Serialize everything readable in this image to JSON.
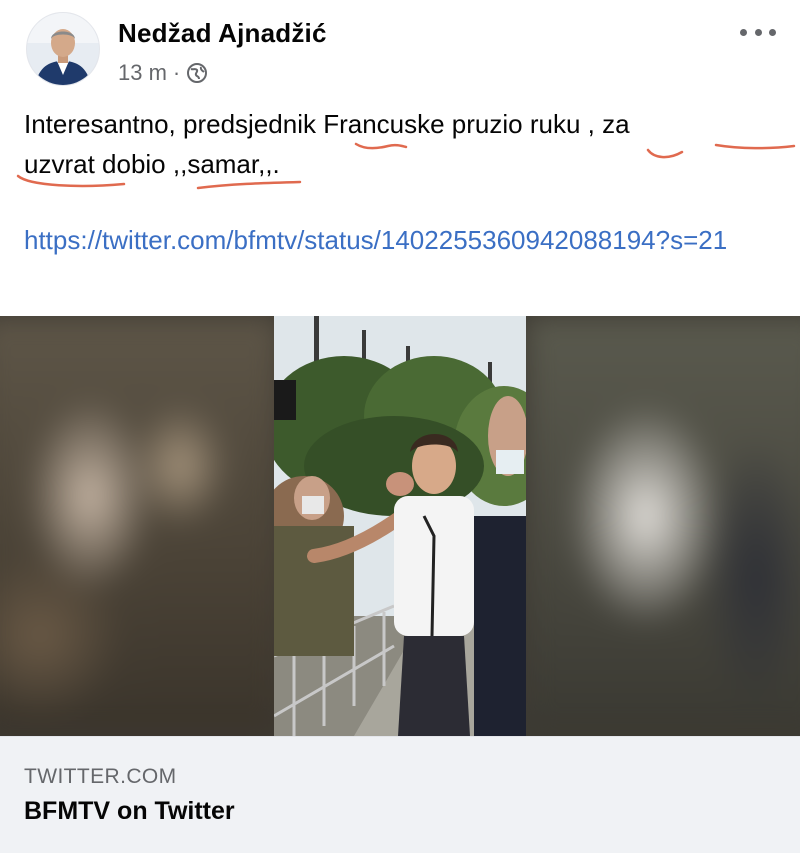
{
  "post": {
    "author": {
      "name": "Nedžad Ajnadžić"
    },
    "meta": {
      "time": "13 m",
      "separator": "·",
      "audience_icon": "globe-icon"
    },
    "more_icon": "more-horizontal-icon",
    "text": "Interesantno, predsjednik  Francuske pruzio ruku , za\nuzvrat dobio ,,samar,,.",
    "link": {
      "url_display": "https://twitter.com/bfmtv/status/1402255360942088194?s=21"
    },
    "media": {
      "type": "video-thumbnail"
    },
    "link_preview": {
      "domain": "TWITTER.COM",
      "title": "BFMTV on Twitter"
    }
  },
  "colors": {
    "link": "#3b6fc4",
    "annotation": "#e06a4f",
    "meta_text": "#65676b",
    "card_bg": "#f0f2f5"
  }
}
